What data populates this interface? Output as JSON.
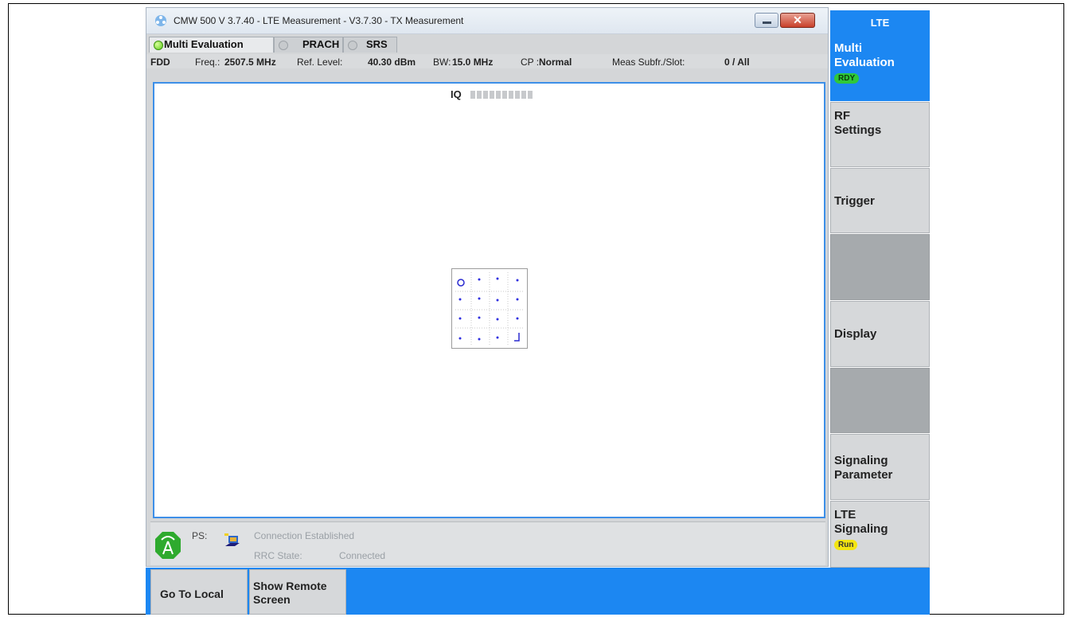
{
  "window": {
    "title": "CMW 500 V 3.7.40 - LTE Measurement  - V3.7.30 - TX Measurement",
    "close_glyph": "✕"
  },
  "tabs": [
    {
      "label": "Multi Evaluation",
      "active": true
    },
    {
      "label": "PRACH",
      "active": false
    },
    {
      "label": "SRS",
      "active": false
    }
  ],
  "info_bar": {
    "mode": "FDD",
    "freq_label": "Freq.:",
    "freq_value": "2507.5 MHz",
    "ref_level_label": "Ref. Level:",
    "ref_level_value": "40.30 dBm",
    "bw_label": "BW:",
    "bw_value": "15.0 MHz",
    "cp_label": "CP :",
    "cp_value": "Normal",
    "meas_label": "Meas Subfr./Slot:",
    "meas_value": "0  / All"
  },
  "plot": {
    "title": "IQ"
  },
  "status": {
    "ps_label": "PS:",
    "connection_text": "Connection Established",
    "rrc_label": "RRC State:",
    "rrc_value": "Connected"
  },
  "softkeys": {
    "header": "LTE",
    "items": [
      {
        "line1": "Multi",
        "line2": "Evaluation",
        "badge": "RDY"
      },
      {
        "line1": "RF",
        "line2": "Settings"
      },
      {
        "line1": "Trigger"
      },
      {
        "line1": "Display"
      },
      {
        "line1": "Signaling",
        "line2": "Parameter"
      },
      {
        "line1": "LTE",
        "line2": "Signaling",
        "badge": "Run"
      }
    ]
  },
  "bottom_buttons": [
    {
      "line1": "Go To Local"
    },
    {
      "line1": "Show Remote",
      "line2": "Screen"
    }
  ],
  "colors": {
    "accent_blue": "#1c87f2",
    "plot_border": "#3d8fe8",
    "rdy_green": "#2fc83a",
    "run_yellow": "#f3e511"
  }
}
